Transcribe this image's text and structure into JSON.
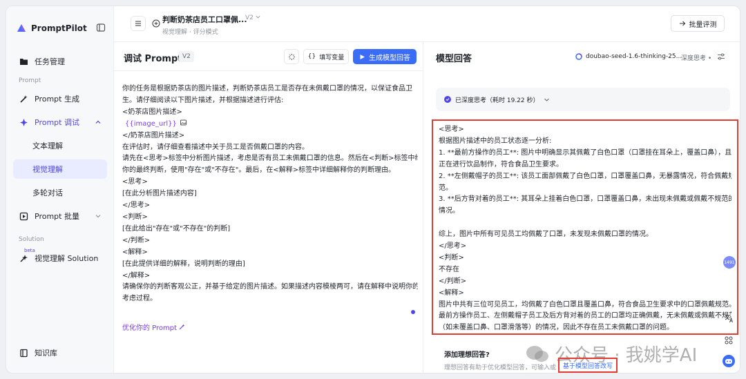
{
  "app": {
    "name": "PromptPilot"
  },
  "sidebar": {
    "items": [
      {
        "label": "任务管理"
      },
      {
        "label": "Prompt 生成"
      },
      {
        "label": "Prompt 调试"
      },
      {
        "label": "文本理解"
      },
      {
        "label": "视觉理解"
      },
      {
        "label": "多轮对话"
      },
      {
        "label": "Prompt 批量"
      },
      {
        "label": "视觉理解 Solution"
      },
      {
        "label": "知识库"
      }
    ],
    "section_prompt": "Prompt",
    "section_solution": "Solution",
    "beta": "beta"
  },
  "header": {
    "title": "判断奶茶店员工口罩佩...",
    "version": "V2",
    "subtitle": "视觉理解 · 评分模式",
    "batch_button": "批量评测"
  },
  "left": {
    "title": "调试 Prompt",
    "version": "V2",
    "var_button": "填写变量",
    "generate_button": "生成模型回答",
    "lines": [
      "你的任务是根据奶茶店的图片描述，判断奶茶店员工是否存在未佩戴口罩的情况，以保证食品卫",
      "生。请仔细阅读以下图片描述，并根据描述进行评估:",
      "<奶茶店图片描述>",
      "__VAR__",
      "</奶茶店图片描述>",
      "在评估时，请仔细查看描述中关于员工是否佩戴口罩的内容。",
      "请先在<思考>标签中分析图片描述，考虑是否有员工未佩戴口罩的信息。然后在<判断>标签中给出",
      "你的最终判断，使用\"存在\"或\"不存在\"。最后，在<解释>标签中详细解释你的判断理由。",
      "<思考>",
      "[在此分析图片描述内容]",
      "</思考>",
      "<判断>",
      "[在此给出\"存在\"或\"不存在\"的判断]",
      "</判断>",
      "<解释>",
      "[在此提供详细的解释，说明判断的理由]",
      "</解释>",
      "请确保你的判断客观公正，并基于给定的图片描述。如果描述内容模棱两可，请在解释中说明你的",
      "考虑过程。"
    ],
    "variable_tag": "{{image_url}}",
    "optimize_link": "优化你的 Prompt"
  },
  "right": {
    "title": "模型回答",
    "model": "doubao-seed-1.6-thinking-25...",
    "deep_think": "深度思考 •",
    "think_status": "已深度思考（耗时 19.22 秒）",
    "answer_lines": [
      "<思考>",
      "根据图片描述中的员工状态逐一分析:",
      "1. **最前方操作的员工**: 图片中明确显示其佩戴了白色口罩（口罩挂在耳朵上，覆盖口鼻），且",
      "正在进行饮品制作，符合食品卫生要求。",
      "2. **左侧戴帽子的员工**: 该员工面部佩戴了白色口罩，口罩覆盖口鼻，无暴露情况，符合佩戴规",
      "范。",
      "3. **后方背对着的员工**: 其耳朵上挂着白色口罩，口罩覆盖口鼻，未出现未佩戴或佩戴不规范的",
      "情况。",
      "",
      "综上，图片中所有可见员工均佩戴了口罩，未发现未佩戴口罩的情况。",
      "</思考>",
      "<判断>",
      "不存在",
      "</判断>",
      "<解释>",
      "图片中共有三位可见员工，均佩戴了白色口罩且覆盖口鼻，符合食品卫生要求中的口罩佩戴规范。",
      "最前方操作员工、左侧戴帽子员工及后方背对着的员工的口罩均正确佩戴，无未佩戴或佩戴不规范",
      "（如未覆盖口鼻、口罩滑落等）的情况，因此不存在员工未佩戴口罩的问题。"
    ],
    "ideal_title": "添加理想回答?",
    "ideal_desc": "理想回答有助于优化模型回答，可输入或",
    "ideal_link": "基于模型回答改写",
    "watermark": "公众号 · 我姚学AI",
    "badge": "1491"
  },
  "colors": {
    "accent": "#4f46e5",
    "primary_button": "#3b6cf6",
    "highlight_box": "#e33b30"
  }
}
